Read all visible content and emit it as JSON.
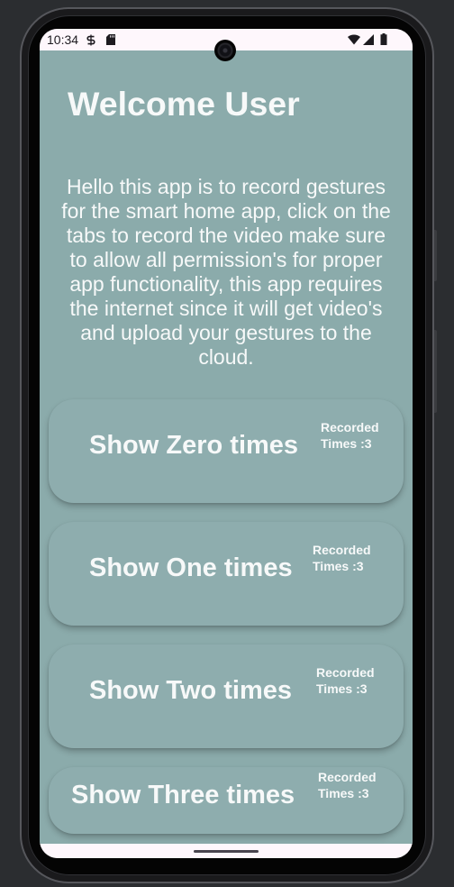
{
  "status_bar": {
    "time": "10:34",
    "icons_left": [
      "notification-icon",
      "sd-card-icon"
    ],
    "icons_right": [
      "wifi-icon",
      "cellular-signal-icon",
      "battery-icon"
    ]
  },
  "app": {
    "title": "Welcome User",
    "description": "Hello this app is to record gestures for the smart home app, click on the tabs to record the video make sure to allow all permission's for proper app functionality, this app requires the internet since it will get video's and upload your gestures to the cloud.",
    "cards": [
      {
        "label": "Show Zero times",
        "recorded": "Recorded Times :3"
      },
      {
        "label": "Show One times",
        "recorded": "Recorded Times :3"
      },
      {
        "label": "Show Two times",
        "recorded": "Recorded Times :3"
      },
      {
        "label": "Show Three times",
        "recorded": "Recorded Times :3"
      }
    ]
  },
  "colors": {
    "outer_background": "#2b2d30",
    "page_background": "#8babab",
    "card_background": "#8eadae",
    "text": "#f7f9f9",
    "system_bar": "#fef7fc",
    "system_foreground": "#1d1b20"
  }
}
